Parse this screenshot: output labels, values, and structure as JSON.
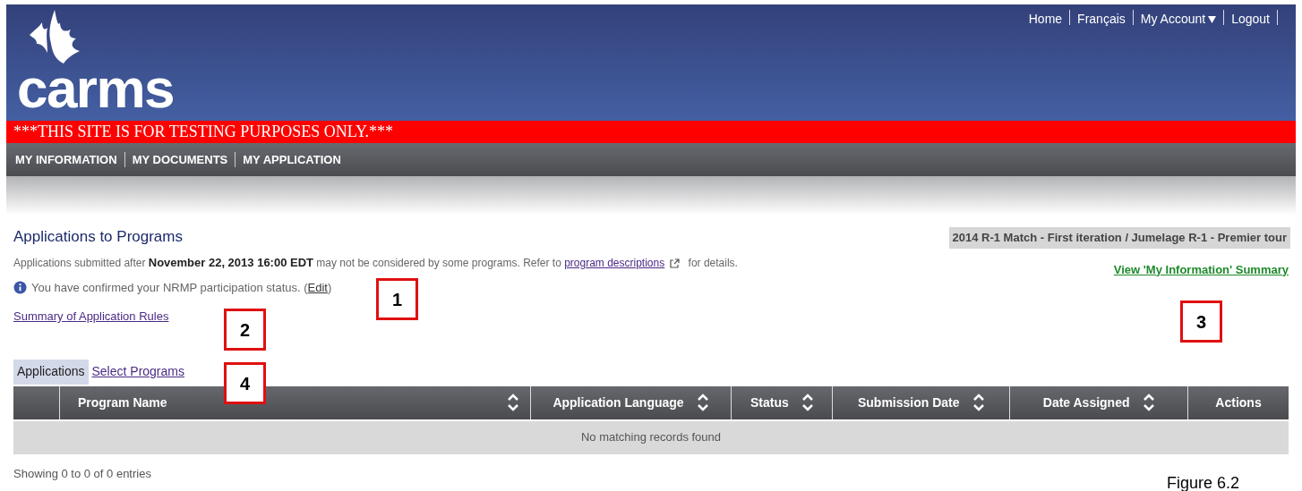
{
  "top_links": [
    {
      "label": "Home"
    },
    {
      "label": "Français"
    },
    {
      "label": "My Account",
      "dropdown": true
    },
    {
      "label": "Logout"
    }
  ],
  "logo": {
    "text": "carms"
  },
  "test_banner": "***THIS SITE IS FOR TESTING PURPOSES ONLY.***",
  "nav": [
    {
      "label": "MY INFORMATION"
    },
    {
      "label": "MY DOCUMENTS"
    },
    {
      "label": "MY APPLICATION"
    }
  ],
  "page_title": "Applications to Programs",
  "match_badge": "2014 R-1 Match - First iteration / Jumelage R-1 - Premier tour",
  "deadline_notice": {
    "text": "Applications submitted after **November 22, 2013 16:00 EDT** may not be considered by some programs. Refer to",
    "link": "program descriptions",
    "after": "for details."
  },
  "summary_link": "View 'My Information' Summary",
  "nrmp_notice": {
    "text": "You have confirmed your NRMP participation status. (",
    "link": "Edit",
    "after": ")"
  },
  "rules_link": "Summary of Application Rules",
  "tabs": [
    {
      "label": "Applications",
      "selected": true
    },
    {
      "label": "Select Programs",
      "selected": false
    }
  ],
  "table": {
    "columns": [
      {
        "sortable": false
      },
      {
        "label": "Program Name",
        "sortable": true
      },
      {
        "label": "Application Language",
        "sortable": true
      },
      {
        "label": "Status",
        "sortable": true
      },
      {
        "label": "Submission Date",
        "sortable": true
      },
      {
        "label": "Date Assigned",
        "sortable": true
      },
      {
        "label": "Actions",
        "sortable": false
      }
    ],
    "empty_message": "No matching records found"
  },
  "table_info": "Showing 0 to 0 of 0 entries",
  "callouts": [
    {
      "label": "1"
    },
    {
      "label": "2"
    },
    {
      "label": "3"
    },
    {
      "label": "4"
    }
  ],
  "figure_caption": "Figure 6.2"
}
